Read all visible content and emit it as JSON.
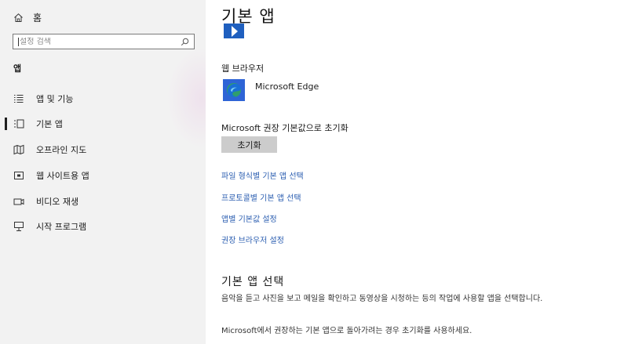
{
  "sidebar": {
    "home_label": "홈",
    "search_placeholder": "설정 검색",
    "section_label": "앱",
    "items": [
      {
        "label": "앱 및 기능",
        "icon": "list-icon"
      },
      {
        "label": "기본 앱",
        "icon": "default-apps-icon",
        "selected": true
      },
      {
        "label": "오프라인 지도",
        "icon": "map-icon"
      },
      {
        "label": "웹 사이트용 앱",
        "icon": "web-apps-icon"
      },
      {
        "label": "비디오 재생",
        "icon": "video-icon"
      },
      {
        "label": "시작 프로그램",
        "icon": "startup-icon"
      }
    ]
  },
  "main": {
    "title": "기본 앱",
    "web_browser_heading": "웹 브라우저",
    "browser_name": "Microsoft Edge",
    "reset_heading": "Microsoft 권장 기본값으로 초기화",
    "reset_button": "초기화",
    "links": [
      "파일 형식별 기본 앱 선택",
      "프로토콜별 기본 앱 선택",
      "앱별 기본값 설정",
      "권장 브라우저 설정"
    ],
    "choose_title": "기본 앱 선택",
    "desc1": "음악을 듣고 사진을 보고 메일을 확인하고 동영상을 시청하는 등의 작업에 사용할 앱을 선택합니다.",
    "desc2": "Microsoft에서 권장하는 기본 앱으로 돌아가려는 경우 초기화를 사용하세요."
  },
  "colors": {
    "sidebar_bg": "#f2f2f2",
    "link": "#2a5db0",
    "button_bg": "#cccccc",
    "accent_tile": "#1f5fbf"
  }
}
